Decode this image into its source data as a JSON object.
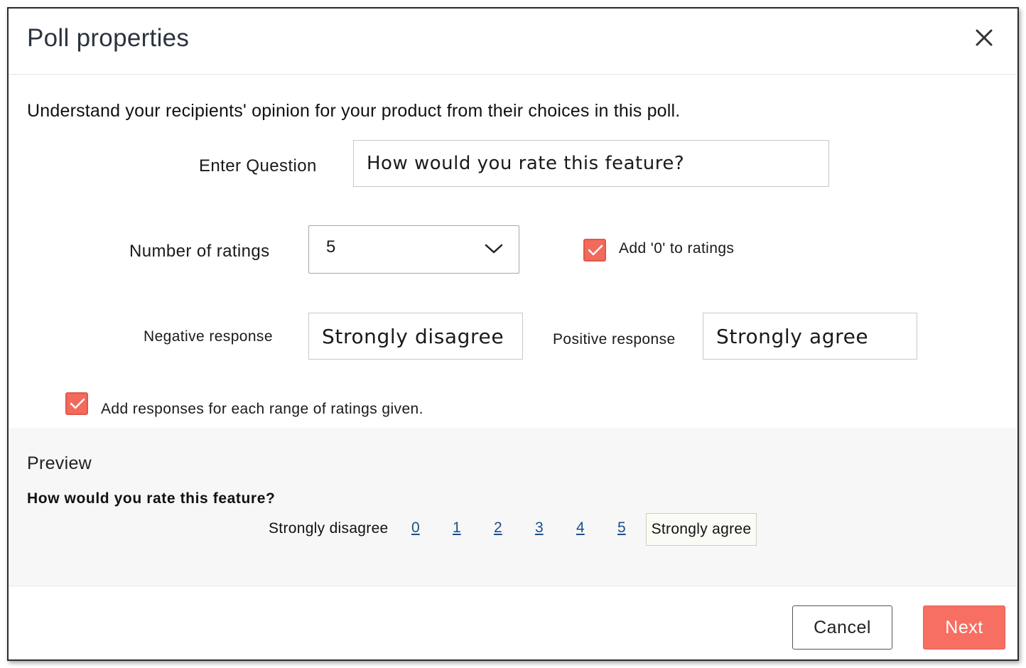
{
  "dialog": {
    "title": "Poll properties",
    "intro": "Understand your recipients' opinion for your product from their choices in this poll."
  },
  "form": {
    "question_label": "Enter Question",
    "question_value": "How would you rate this feature?",
    "ratings_label": "Number of ratings",
    "ratings_value": "5",
    "add_zero_label": "Add '0' to ratings",
    "add_zero_checked": true,
    "negative_label": "Negative response",
    "negative_value": "Strongly disagree",
    "positive_label": "Positive response",
    "positive_value": "Strongly agree",
    "range_responses_label": "Add responses for each range of ratings given.",
    "range_responses_checked": true
  },
  "preview": {
    "title": "Preview",
    "question": "How would you rate this feature?",
    "negative": "Strongly disagree",
    "positive": "Strongly agree",
    "ratings": [
      "0",
      "1",
      "2",
      "3",
      "4",
      "5"
    ]
  },
  "footer": {
    "cancel_label": "Cancel",
    "next_label": "Next"
  },
  "icons": {
    "close": "close-icon",
    "dropdown": "chevron-down-icon",
    "check": "checkmark-icon"
  },
  "colors": {
    "accent": "#f76e63",
    "link": "#1a4f8a"
  }
}
